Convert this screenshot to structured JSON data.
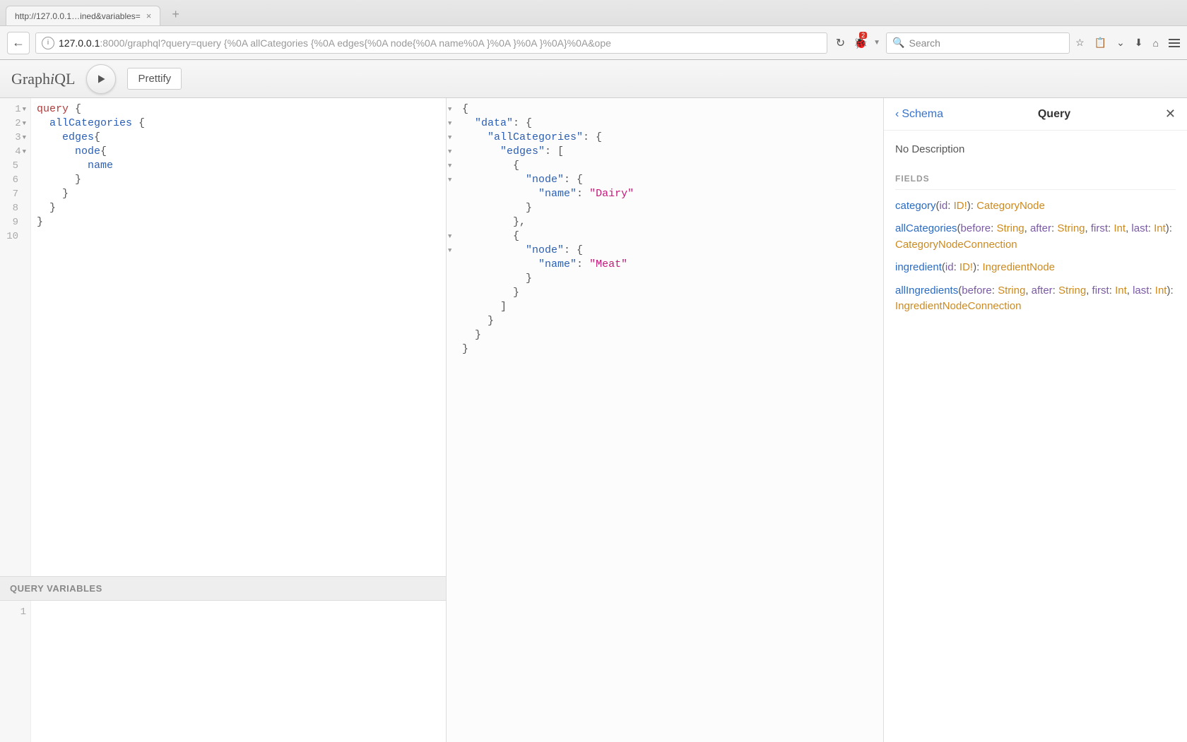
{
  "browser": {
    "tab_title": "http://127.0.0.1…ined&variables=",
    "url_host": "127.0.0.1",
    "url_rest": ":8000/graphql?query=query {%0A  allCategories {%0A    edges{%0A      node{%0A        name%0A      }%0A    }%0A  }%0A}%0A&ope",
    "search_placeholder": "Search",
    "badge": "2"
  },
  "toolbar": {
    "logo_prefix": "Graph",
    "logo_ital": "i",
    "logo_suffix": "QL",
    "prettify": "Prettify"
  },
  "editor": {
    "lines": [
      "1",
      "2",
      "3",
      "4",
      "5",
      "6",
      "7",
      "8",
      "9",
      "10"
    ],
    "tokens": [
      [
        {
          "t": "kw",
          "v": "query"
        },
        {
          "t": "pn",
          "v": " {"
        }
      ],
      [
        {
          "t": "pn",
          "v": "  "
        },
        {
          "t": "fld",
          "v": "allCategories"
        },
        {
          "t": "pn",
          "v": " {"
        }
      ],
      [
        {
          "t": "pn",
          "v": "    "
        },
        {
          "t": "fld",
          "v": "edges"
        },
        {
          "t": "pn",
          "v": "{"
        }
      ],
      [
        {
          "t": "pn",
          "v": "      "
        },
        {
          "t": "fld",
          "v": "node"
        },
        {
          "t": "pn",
          "v": "{"
        }
      ],
      [
        {
          "t": "pn",
          "v": "        "
        },
        {
          "t": "fld",
          "v": "name"
        }
      ],
      [
        {
          "t": "pn",
          "v": "      }"
        }
      ],
      [
        {
          "t": "pn",
          "v": "    }"
        }
      ],
      [
        {
          "t": "pn",
          "v": "  }"
        }
      ],
      [
        {
          "t": "pn",
          "v": "}"
        }
      ],
      [
        {
          "t": "pn",
          "v": ""
        }
      ]
    ],
    "query_variables_label": "QUERY VARIABLES",
    "variables_lines": [
      "1"
    ]
  },
  "result": {
    "tokens": [
      [
        {
          "t": "pn",
          "v": "{"
        }
      ],
      [
        {
          "t": "pn",
          "v": "  "
        },
        {
          "t": "fld",
          "v": "\"data\""
        },
        {
          "t": "pn",
          "v": ": {"
        }
      ],
      [
        {
          "t": "pn",
          "v": "    "
        },
        {
          "t": "fld",
          "v": "\"allCategories\""
        },
        {
          "t": "pn",
          "v": ": {"
        }
      ],
      [
        {
          "t": "pn",
          "v": "      "
        },
        {
          "t": "fld",
          "v": "\"edges\""
        },
        {
          "t": "pn",
          "v": ": ["
        }
      ],
      [
        {
          "t": "pn",
          "v": "        {"
        }
      ],
      [
        {
          "t": "pn",
          "v": "          "
        },
        {
          "t": "fld",
          "v": "\"node\""
        },
        {
          "t": "pn",
          "v": ": {"
        }
      ],
      [
        {
          "t": "pn",
          "v": "            "
        },
        {
          "t": "fld",
          "v": "\"name\""
        },
        {
          "t": "pn",
          "v": ": "
        },
        {
          "t": "str",
          "v": "\"Dairy\""
        }
      ],
      [
        {
          "t": "pn",
          "v": "          }"
        }
      ],
      [
        {
          "t": "pn",
          "v": "        },"
        }
      ],
      [
        {
          "t": "pn",
          "v": "        {"
        }
      ],
      [
        {
          "t": "pn",
          "v": "          "
        },
        {
          "t": "fld",
          "v": "\"node\""
        },
        {
          "t": "pn",
          "v": ": {"
        }
      ],
      [
        {
          "t": "pn",
          "v": "            "
        },
        {
          "t": "fld",
          "v": "\"name\""
        },
        {
          "t": "pn",
          "v": ": "
        },
        {
          "t": "str",
          "v": "\"Meat\""
        }
      ],
      [
        {
          "t": "pn",
          "v": "          }"
        }
      ],
      [
        {
          "t": "pn",
          "v": "        }"
        }
      ],
      [
        {
          "t": "pn",
          "v": "      ]"
        }
      ],
      [
        {
          "t": "pn",
          "v": "    }"
        }
      ],
      [
        {
          "t": "pn",
          "v": "  }"
        }
      ],
      [
        {
          "t": "pn",
          "v": "}"
        }
      ]
    ]
  },
  "docs": {
    "back_label": "Schema",
    "title": "Query",
    "description": "No Description",
    "fields_label": "FIELDS",
    "fields": [
      {
        "name": "category",
        "args": [
          {
            "n": "id",
            "t": "ID!"
          }
        ],
        "returns": "CategoryNode"
      },
      {
        "name": "allCategories",
        "args": [
          {
            "n": "before",
            "t": "String"
          },
          {
            "n": "after",
            "t": "String"
          },
          {
            "n": "first",
            "t": "Int"
          },
          {
            "n": "last",
            "t": "Int"
          }
        ],
        "returns": "CategoryNodeConnection"
      },
      {
        "name": "ingredient",
        "args": [
          {
            "n": "id",
            "t": "ID!"
          }
        ],
        "returns": "IngredientNode"
      },
      {
        "name": "allIngredients",
        "args": [
          {
            "n": "before",
            "t": "String"
          },
          {
            "n": "after",
            "t": "String"
          },
          {
            "n": "first",
            "t": "Int"
          },
          {
            "n": "last",
            "t": "Int"
          }
        ],
        "returns": "IngredientNodeConnection"
      }
    ]
  }
}
